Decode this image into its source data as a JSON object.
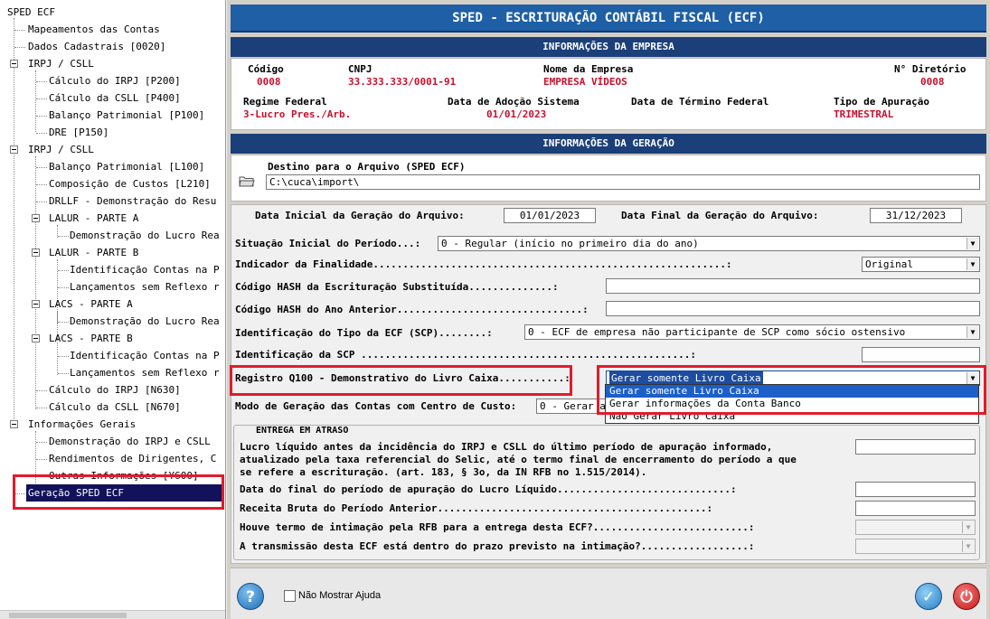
{
  "tree": {
    "items": [
      {
        "label": "SPED ECF"
      },
      {
        "label": "Mapeamentos das Contas"
      },
      {
        "label": "Dados Cadastrais [0020]"
      },
      {
        "label": "IRPJ / CSLL"
      },
      {
        "label": "Cálculo do IRPJ [P200]"
      },
      {
        "label": "Cálculo da CSLL [P400]"
      },
      {
        "label": "Balanço Patrimonial [P100]"
      },
      {
        "label": "DRE [P150]"
      },
      {
        "label": "IRPJ / CSLL"
      },
      {
        "label": "Balanço Patrimonial [L100]"
      },
      {
        "label": "Composição de Custos [L210]"
      },
      {
        "label": "DRLLF - Demonstração do Resu"
      },
      {
        "label": "LALUR - PARTE A"
      },
      {
        "label": "Demonstração do Lucro Rea"
      },
      {
        "label": "LALUR - PARTE B"
      },
      {
        "label": "Identificação Contas na P"
      },
      {
        "label": "Lançamentos sem Reflexo r"
      },
      {
        "label": "LACS - PARTE A"
      },
      {
        "label": "Demonstração do Lucro Rea"
      },
      {
        "label": "LACS - PARTE B"
      },
      {
        "label": "Identificação Contas na P"
      },
      {
        "label": "Lançamentos sem Reflexo r"
      },
      {
        "label": "Cálculo do IRPJ [N630]"
      },
      {
        "label": "Cálculo da CSLL [N670]"
      },
      {
        "label": "Informações Gerais"
      },
      {
        "label": "Demonstração do IRPJ e CSLL"
      },
      {
        "label": "Rendimentos de Dirigentes, C"
      },
      {
        "label": "Outras Informações [Y600]"
      },
      {
        "label": "Geração SPED ECF"
      }
    ]
  },
  "header": {
    "title": "SPED - ESCRITURAÇÃO CONTÁBIL FISCAL (ECF)"
  },
  "empresa": {
    "section_title": "INFORMAÇÕES DA EMPRESA",
    "codigo_label": "Código",
    "codigo": "0008",
    "cnpj_label": "CNPJ",
    "cnpj": "33.333.333/0001-91",
    "nome_label": "Nome da Empresa",
    "nome": "EMPRESA VÍDEOS",
    "diretorio_label": "N° Diretório",
    "diretorio": "0008",
    "regime_label": "Regime Federal",
    "regime": "3-Lucro Pres./Arb.",
    "adocao_label": "Data de Adoção Sistema",
    "adocao": "01/01/2023",
    "termino_label": "Data de Término Federal",
    "termino": "",
    "apuracao_label": "Tipo de Apuração",
    "apuracao": "TRIMESTRAL"
  },
  "geracao": {
    "section_title": "INFORMAÇÕES DA GERAÇÃO",
    "destino_label": "Destino para o Arquivo (SPED ECF)",
    "destino": "C:\\cuca\\import\\",
    "data_inicial_label": "Data Inicial da Geração do Arquivo:",
    "data_inicial": "01/01/2023",
    "data_final_label": "Data Final da Geração do Arquivo:",
    "data_final": "31/12/2023"
  },
  "form": {
    "situacao_label": "Situação Inicial do Período...:",
    "situacao_value": "0 - Regular (início no primeiro dia do ano)",
    "finalidade_label": "Indicador da Finalidade...........................................................:",
    "finalidade_value": "Original",
    "hash_label": "Código HASH da Escrituração Substituída..............:",
    "hash_value": "",
    "hash_ant_label": "Código HASH do Ano Anterior...............................:",
    "hash_ant_value": "",
    "tipo_ecf_label": "Identificação do Tipo da ECF (SCP)........:",
    "tipo_ecf_value": "0 - ECF de empresa não participante de SCP como sócio ostensivo",
    "scp_label": "Identificação da SCP .......................................................:",
    "scp_value": "",
    "q100_label": "Registro Q100 - Demonstrativo do Livro Caixa...........:",
    "q100_value": "Gerar somente Livro Caixa",
    "q100_options": [
      "Gerar somente Livro Caixa",
      "Gerar informações da Conta Banco",
      "Não Gerar Livro Caixa"
    ],
    "centro_custo_label": "Modo de Geração das Contas com Centro de Custo:",
    "centro_custo_value": "0 - Gerar a"
  },
  "atraso": {
    "title": "ENTREGA EM ATRASO",
    "lucro_label_1": "Lucro líquido antes da incidência do IRPJ e CSLL do último período de apuração informado,",
    "lucro_label_2": "atualizado pela taxa referencial do Selic, até o termo final de encerramento do período a que",
    "lucro_label_3": "se refere a escrituração. (art. 183, § 3o, da IN RFB no 1.515/2014).",
    "data_final_label": "Data do final do período de apuração do Lucro Líquido.............................:",
    "receita_label": "Receita Bruta do Período Anterior.............................................:",
    "intimacao_label": "Houve termo de intimação pela RFB para a entrega desta ECF?..........................:",
    "prazo_label": "A transmissão desta ECF está dentro do prazo previsto na intimação?..................:"
  },
  "footer": {
    "help_glyph": "?",
    "nao_mostrar_label": "Não Mostrar Ajuda",
    "ok_glyph": "✓",
    "power_glyph": "⏻"
  },
  "colors": {
    "title_bar": "#1e5fa6",
    "section_bar": "#1b3f78",
    "value_red": "#c8102e",
    "highlight_red": "#e21b2c",
    "selection": "#12125a"
  }
}
